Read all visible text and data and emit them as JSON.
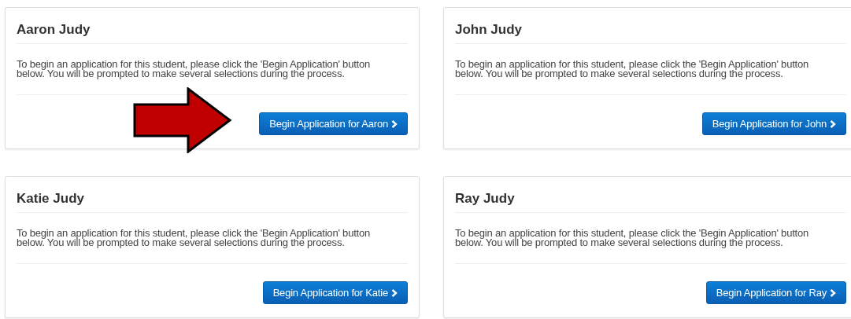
{
  "students": [
    {
      "name": "Aaron Judy",
      "description": "To begin an application for this student, please click the 'Begin Application' button below. You will be prompted to make several selections during the process.",
      "button": "Begin Application for Aaron",
      "highlighted": true
    },
    {
      "name": "John Judy",
      "description": "To begin an application for this student, please click the 'Begin Application' button below. You will be prompted to make several selections during the process.",
      "button": "Begin Application for John",
      "highlighted": false
    },
    {
      "name": "Katie Judy",
      "description": "To begin an application for this student, please click the 'Begin Application' button below. You will be prompted to make several selections during the process.",
      "button": "Begin Application for Katie",
      "highlighted": false
    },
    {
      "name": "Ray Judy",
      "description": "To begin an application for this student, please click the 'Begin Application' button below. You will be prompted to make several selections during the process.",
      "button": "Begin Application for Ray",
      "highlighted": false
    }
  ]
}
